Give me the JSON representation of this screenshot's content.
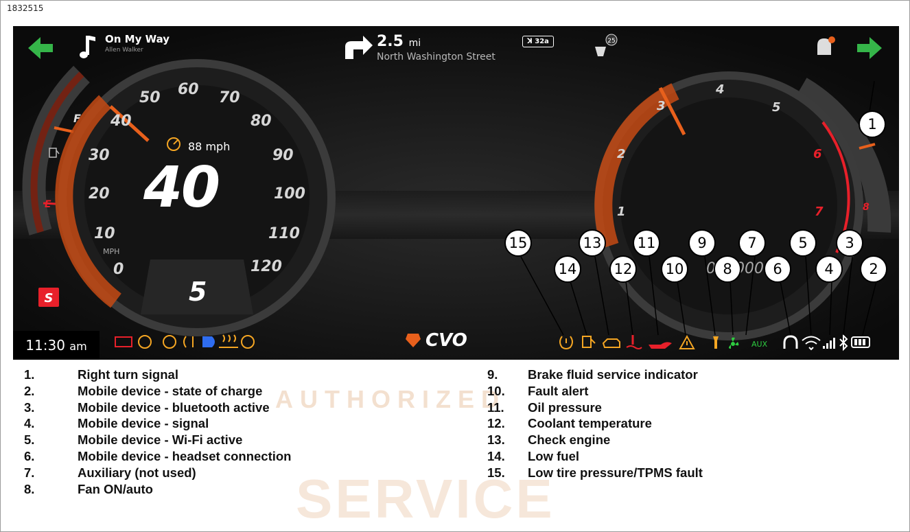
{
  "figure_id": "1832515",
  "dashboard": {
    "media": {
      "track": "On My Way",
      "artist": "Allen Walker"
    },
    "navigation": {
      "distance_value": "2.5",
      "distance_unit": "mi",
      "street": "North Washington Street",
      "exit": "32a"
    },
    "notification_count": "25",
    "speed_limit": "88 mph",
    "speed": "40",
    "speed_unit": "MPH",
    "gear": "5",
    "clock_time": "11:30",
    "clock_ampm": "am",
    "aux_label": "AUX",
    "fuel_labels": [
      "F",
      "E"
    ],
    "speedo_numbers": [
      "0",
      "10",
      "20",
      "30",
      "40",
      "50",
      "60",
      "70",
      "80",
      "90",
      "100",
      "110",
      "120"
    ],
    "tach_numbers": [
      "1",
      "2",
      "3",
      "4",
      "5",
      "6",
      "7",
      "8"
    ],
    "brand": "CVO",
    "colors": {
      "turn_signal": "#35b549",
      "warning_amber": "#f5a623",
      "warning_red": "#e8202a",
      "gauge_orange": "#e8601c",
      "screen_bg": "#111111"
    }
  },
  "callouts": [
    "15",
    "14",
    "13",
    "12",
    "11",
    "10",
    "9",
    "8",
    "7",
    "6",
    "5",
    "4",
    "3",
    "2",
    "1"
  ],
  "legend_left": [
    {
      "num": "1.",
      "text": "Right turn signal"
    },
    {
      "num": "2.",
      "text": "Mobile device - state of charge"
    },
    {
      "num": "3.",
      "text": "Mobile device - bluetooth active"
    },
    {
      "num": "4.",
      "text": "Mobile device - signal"
    },
    {
      "num": "5.",
      "text": "Mobile device - Wi-Fi active"
    },
    {
      "num": "6.",
      "text": "Mobile device - headset connection"
    },
    {
      "num": "7.",
      "text": "Auxiliary (not used)"
    },
    {
      "num": "8.",
      "text": "Fan ON/auto"
    }
  ],
  "legend_right": [
    {
      "num": "9.",
      "text": "Brake fluid service indicator"
    },
    {
      "num": "10.",
      "text": "Fault alert"
    },
    {
      "num": "11.",
      "text": "Oil pressure"
    },
    {
      "num": "12.",
      "text": "Coolant temperature"
    },
    {
      "num": "13.",
      "text": "Check engine"
    },
    {
      "num": "14.",
      "text": "Low fuel"
    },
    {
      "num": "15.",
      "text": "Low tire pressure/TPMS fault"
    }
  ],
  "watermark": [
    "AUTHORIZED",
    "SERVICE"
  ]
}
